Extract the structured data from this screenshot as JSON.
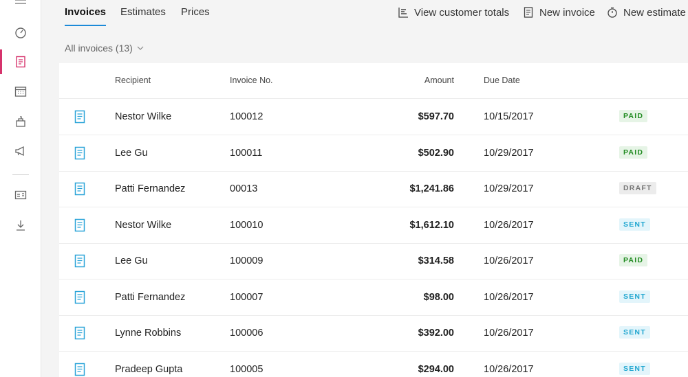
{
  "nav": {
    "tabs": [
      {
        "label": "Invoices",
        "active": true
      },
      {
        "label": "Estimates",
        "active": false
      },
      {
        "label": "Prices",
        "active": false
      }
    ],
    "commands": {
      "view_totals": "View customer totals",
      "new_invoice": "New invoice",
      "new_estimate": "New estimate"
    }
  },
  "rail": {
    "items": [
      "menu-icon",
      "dashboard-icon",
      "invoice-icon",
      "calendar-icon",
      "inventory-icon",
      "megaphone-icon",
      "contact-card-icon",
      "download-icon"
    ],
    "active": "invoice-icon",
    "accent": "#d6336c"
  },
  "filter": {
    "label": "All invoices (13)"
  },
  "table": {
    "headers": {
      "recipient": "Recipient",
      "invoice_no": "Invoice No.",
      "amount": "Amount",
      "due_date": "Due Date"
    },
    "rows": [
      {
        "recipient": "Nestor Wilke",
        "invoice_no": "100012",
        "amount": "$597.70",
        "due_date": "10/15/2017",
        "status": "PAID",
        "status_type": "paid"
      },
      {
        "recipient": "Lee Gu",
        "invoice_no": "100011",
        "amount": "$502.90",
        "due_date": "10/29/2017",
        "status": "PAID",
        "status_type": "paid"
      },
      {
        "recipient": "Patti Fernandez",
        "invoice_no": "00013",
        "amount": "$1,241.86",
        "due_date": "10/29/2017",
        "status": "DRAFT",
        "status_type": "draft"
      },
      {
        "recipient": "Nestor Wilke",
        "invoice_no": "100010",
        "amount": "$1,612.10",
        "due_date": "10/26/2017",
        "status": "SENT",
        "status_type": "sent"
      },
      {
        "recipient": "Lee Gu",
        "invoice_no": "100009",
        "amount": "$314.58",
        "due_date": "10/26/2017",
        "status": "PAID",
        "status_type": "paid"
      },
      {
        "recipient": "Patti Fernandez",
        "invoice_no": "100007",
        "amount": "$98.00",
        "due_date": "10/26/2017",
        "status": "SENT",
        "status_type": "sent"
      },
      {
        "recipient": "Lynne Robbins",
        "invoice_no": "100006",
        "amount": "$392.00",
        "due_date": "10/26/2017",
        "status": "SENT",
        "status_type": "sent"
      },
      {
        "recipient": "Pradeep Gupta",
        "invoice_no": "100005",
        "amount": "$294.00",
        "due_date": "10/26/2017",
        "status": "SENT",
        "status_type": "sent"
      }
    ]
  },
  "colors": {
    "tab_underline": "#1c8ad8",
    "row_icon": "#29a3d8",
    "paid": "#1f8a1f",
    "sent": "#20a6d0",
    "draft": "#777777"
  }
}
